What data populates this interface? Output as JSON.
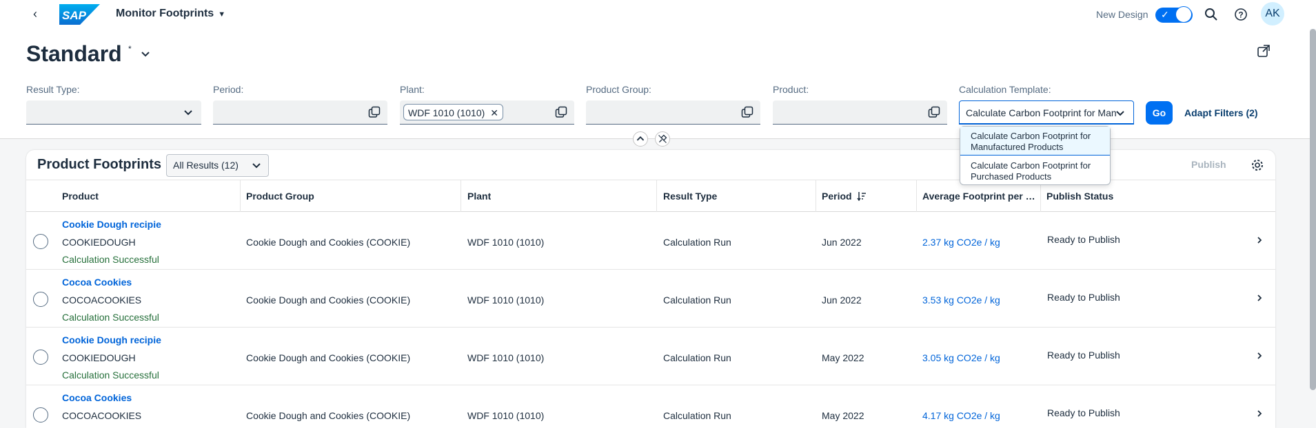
{
  "shell": {
    "back": "‹",
    "app_title": "Monitor Footprints",
    "new_design_label": "New Design",
    "avatar_initials": "AK"
  },
  "header": {
    "variant_name": "Standard",
    "variant_modified": "*"
  },
  "filters": {
    "result_type_label": "Result Type:",
    "period_label": "Period:",
    "plant_label": "Plant:",
    "plant_token": "WDF 1010 (1010)",
    "product_group_label": "Product Group:",
    "product_label": "Product:",
    "calc_template_label": "Calculation Template:",
    "calc_template_value": "Calculate Carbon Footprint for Manufactured Products",
    "go_label": "Go",
    "adapt_filters_label": "Adapt Filters (2)"
  },
  "dropdown": {
    "options": [
      "Calculate Carbon Footprint for Manufactured Products",
      "Calculate Carbon Footprint for Purchased Products"
    ],
    "selected_index": 0
  },
  "table": {
    "title": "Product Footprints",
    "view_select": "All Results (12)",
    "publish_label": "Publish",
    "columns": [
      "Product",
      "Product Group",
      "Plant",
      "Result Type",
      "Period",
      "Average Footprint per …",
      "Publish Status"
    ],
    "rows": [
      {
        "name": "Cookie Dough recipie",
        "code": "COOKIEDOUGH",
        "status": "Calculation Successful",
        "group": "Cookie Dough and Cookies (COOKIE)",
        "plant": "WDF 1010 (1010)",
        "result_type": "Calculation Run",
        "period": "Jun 2022",
        "footprint": "2.37 kg CO2e / kg",
        "publish_status": "Ready to Publish"
      },
      {
        "name": "Cocoa Cookies",
        "code": "COCOACOOKIES",
        "status": "Calculation Successful",
        "group": "Cookie Dough and Cookies (COOKIE)",
        "plant": "WDF 1010 (1010)",
        "result_type": "Calculation Run",
        "period": "Jun 2022",
        "footprint": "3.53 kg CO2e / kg",
        "publish_status": "Ready to Publish"
      },
      {
        "name": "Cookie Dough recipie",
        "code": "COOKIEDOUGH",
        "status": "Calculation Successful",
        "group": "Cookie Dough and Cookies (COOKIE)",
        "plant": "WDF 1010 (1010)",
        "result_type": "Calculation Run",
        "period": "May 2022",
        "footprint": "3.05 kg CO2e / kg",
        "publish_status": "Ready to Publish"
      },
      {
        "name": "Cocoa Cookies",
        "code": "COCOACOOKIES",
        "status": "",
        "group": "Cookie Dough and Cookies (COOKIE)",
        "plant": "WDF 1010 (1010)",
        "result_type": "Calculation Run",
        "period": "May 2022",
        "footprint": "4.17 kg CO2e / kg",
        "publish_status": "Ready to Publish"
      }
    ]
  },
  "colors": {
    "accent": "#0070f2",
    "link": "#0064d9",
    "success": "#256f3a",
    "brand_logo": "#0a6ed1"
  }
}
